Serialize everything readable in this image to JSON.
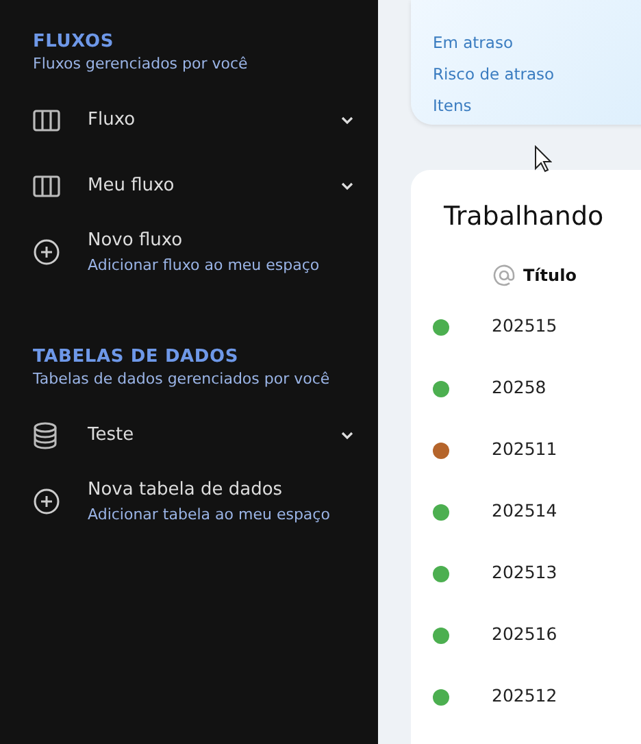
{
  "sidebar": {
    "sections": [
      {
        "title": "FLUXOS",
        "subtitle": "Fluxos gerenciados por você",
        "items": [
          {
            "kind": "board",
            "label": "Fluxo",
            "expandable": true
          },
          {
            "kind": "board",
            "label": "Meu fluxo",
            "expandable": true
          },
          {
            "kind": "add",
            "label": "Novo fluxo",
            "description": "Adicionar fluxo ao meu espaço"
          }
        ]
      },
      {
        "title": "TABELAS DE DADOS",
        "subtitle": "Tabelas de dados gerenciados por você",
        "items": [
          {
            "kind": "table",
            "label": "Teste",
            "expandable": true
          },
          {
            "kind": "add",
            "label": "Nova tabela de dados",
            "description": "Adicionar tabela ao meu espaço"
          }
        ]
      }
    ]
  },
  "summary_card": {
    "links": [
      "Em atraso",
      "Risco de atraso",
      "Itens"
    ]
  },
  "work_card": {
    "title": "Trabalhando",
    "columns": [
      "Título"
    ],
    "rows": [
      {
        "color": "#4caf50",
        "title": "202515"
      },
      {
        "color": "#4caf50",
        "title": "20258"
      },
      {
        "color": "#b5652b",
        "title": "202511"
      },
      {
        "color": "#4caf50",
        "title": "202514"
      },
      {
        "color": "#4caf50",
        "title": "202513"
      },
      {
        "color": "#4caf50",
        "title": "202516"
      },
      {
        "color": "#4caf50",
        "title": "202512"
      }
    ]
  }
}
